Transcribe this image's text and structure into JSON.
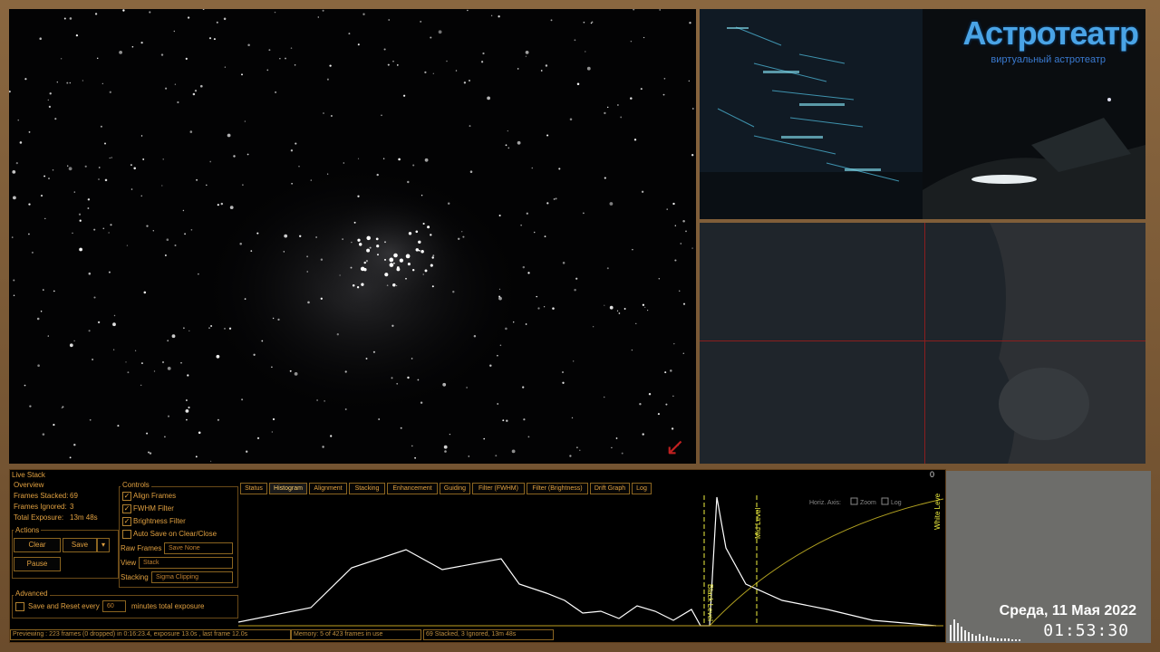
{
  "brand": {
    "title": "Астротеатр",
    "subtitle": "виртуальный астротеатр"
  },
  "overlay": {
    "date": "Среда, 11 Мая 2022",
    "time": "01:53:30"
  },
  "live_stack": {
    "title": "Live Stack",
    "close_label": "0",
    "overview": {
      "label": "Overview",
      "frames_stacked_label": "Frames Stacked:",
      "frames_stacked": "69",
      "frames_ignored_label": "Frames Ignored:",
      "frames_ignored": "3",
      "total_exposure_label": "Total Exposure:",
      "total_exposure": "13m 48s"
    },
    "actions": {
      "label": "Actions",
      "clear": "Clear",
      "save": "Save",
      "save_menu": "▾",
      "pause": "Pause"
    },
    "advanced": {
      "label": "Advanced",
      "save_reset_label": "Save and Reset every",
      "minutes_value": "60",
      "minutes_label": "minutes total exposure"
    },
    "controls": {
      "label": "Controls",
      "align_frames": "Align Frames",
      "fwhm_filter": "FWHM Filter",
      "brightness_filter": "Brightness Filter",
      "auto_save": "Auto Save on Clear/Close",
      "raw_frames_label": "Raw Frames",
      "raw_frames_value": "Save None",
      "view_label": "View",
      "view_value": "Stack",
      "stacking_label": "Stacking",
      "stacking_value": "Sigma Clipping"
    },
    "tabs": [
      "Status",
      "Histogram",
      "Alignment",
      "Stacking",
      "Enhancement",
      "Guiding",
      "Filter (FWHM)",
      "Filter (Brightness)",
      "Drift Graph",
      "Log"
    ],
    "histogram": {
      "horiz_axis_label": "Horiz. Axis:",
      "zoom_label": "Zoom",
      "log_label": "Log",
      "black_level_label": "Black Level",
      "mid_level_label": "Mid Level",
      "white_level_label": "White Level",
      "colors": {
        "curve": "#ffffff",
        "stretch": "#b0a020",
        "marker": "#f0f040"
      }
    },
    "status_bar": {
      "previewing": "Previewing : 223 frames (0 dropped) in 0:16:23.4, exposure 13.0s , last frame 12.0s",
      "memory": "Memory: 5 of 423 frames in use",
      "stacked": "69 Stacked, 3 Ignored, 13m 48s"
    }
  }
}
